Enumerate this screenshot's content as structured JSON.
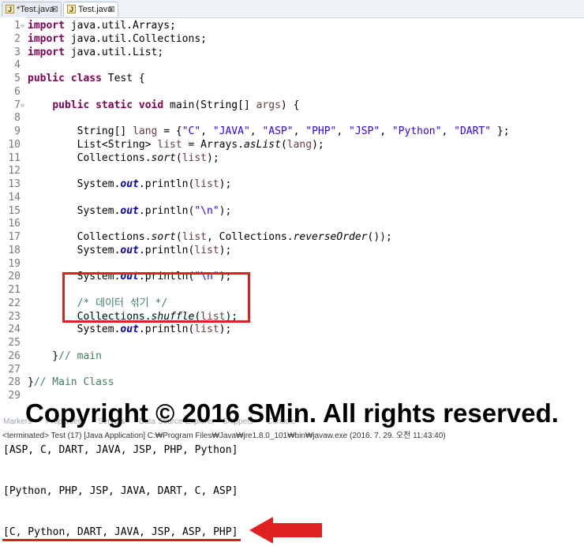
{
  "tabs": [
    {
      "label": "*Test.java",
      "close": "⊠"
    },
    {
      "label": "Test.java",
      "close": "⊠"
    }
  ],
  "code_lines": [
    {
      "n": "1",
      "fold": "⊖",
      "html": "<span class=\"kw\">import</span> java.util.Arrays;"
    },
    {
      "n": "2",
      "fold": "",
      "html": "<span class=\"kw\">import</span> java.util.Collections;"
    },
    {
      "n": "3",
      "fold": "",
      "html": "<span class=\"kw\">import</span> java.util.List;"
    },
    {
      "n": "4",
      "fold": "",
      "html": ""
    },
    {
      "n": "5",
      "fold": "",
      "html": "<span class=\"kw\">public class</span> Test {"
    },
    {
      "n": "6",
      "fold": "",
      "html": ""
    },
    {
      "n": "7",
      "fold": "⊖",
      "html": "    <span class=\"kw\">public static void</span> main(String[] <span class=\"var\">args</span>) {"
    },
    {
      "n": "8",
      "fold": "",
      "html": ""
    },
    {
      "n": "9",
      "fold": "",
      "html": "        String[] <span class=\"var\">lang</span> = {<span class=\"str\">\"C\"</span>, <span class=\"str\">\"JAVA\"</span>, <span class=\"str\">\"ASP\"</span>, <span class=\"str\">\"PHP\"</span>, <span class=\"str\">\"JSP\"</span>, <span class=\"str\">\"Python\"</span>, <span class=\"str\">\"DART\"</span> };"
    },
    {
      "n": "10",
      "fold": "",
      "html": "        List&lt;String&gt; <span class=\"var\">list</span> = Arrays.<span class=\"it\">asList</span>(<span class=\"var\">lang</span>);"
    },
    {
      "n": "11",
      "fold": "",
      "html": "        Collections.<span class=\"it\">sort</span>(<span class=\"var\">list</span>);"
    },
    {
      "n": "12",
      "fold": "",
      "html": ""
    },
    {
      "n": "13",
      "fold": "",
      "html": "        System.<span class=\"fld\">out</span>.println(<span class=\"var\">list</span>);"
    },
    {
      "n": "14",
      "fold": "",
      "html": ""
    },
    {
      "n": "15",
      "fold": "",
      "html": "        System.<span class=\"fld\">out</span>.println(<span class=\"str\">\"\\n\"</span>);"
    },
    {
      "n": "16",
      "fold": "",
      "html": ""
    },
    {
      "n": "17",
      "fold": "",
      "html": "        Collections.<span class=\"it\">sort</span>(<span class=\"var\">list</span>, Collections.<span class=\"it\">reverseOrder</span>());"
    },
    {
      "n": "18",
      "fold": "",
      "html": "        System.<span class=\"fld\">out</span>.println(<span class=\"var\">list</span>);"
    },
    {
      "n": "19",
      "fold": "",
      "html": ""
    },
    {
      "n": "20",
      "fold": "",
      "html": "        System.<span class=\"fld\">out</span>.println(<span class=\"str\">\"\\n\"</span>);"
    },
    {
      "n": "21",
      "fold": "",
      "html": ""
    },
    {
      "n": "22",
      "fold": "",
      "html": "        <span class=\"cm\">/* 데이터 섞기 */</span>"
    },
    {
      "n": "23",
      "fold": "",
      "html": "        Collections.<span class=\"it\">shuffle</span>(<span class=\"var\">list</span>);"
    },
    {
      "n": "24",
      "fold": "",
      "html": "        System.<span class=\"fld\">out</span>.println(<span class=\"var\">list</span>);"
    },
    {
      "n": "25",
      "fold": "",
      "html": ""
    },
    {
      "n": "26",
      "fold": "",
      "html": "    }<span class=\"cm\">// main</span>"
    },
    {
      "n": "27",
      "fold": "",
      "html": ""
    },
    {
      "n": "28",
      "fold": "",
      "html": "}<span class=\"cm\">// Main Class</span>"
    },
    {
      "n": "29",
      "fold": "",
      "html": ""
    }
  ],
  "copyright": "Copyright © 2016 SMin. All rights reserved.",
  "view_tabs": [
    "Markers",
    "Properties",
    "Servers",
    "Data Source Explorer",
    "Snippets",
    "Console"
  ],
  "console": {
    "status": "<terminated> Test (17) [Java Application] C:₩Program Files₩Java₩jre1.8.0_101₩bin₩javaw.exe (2016. 7. 29. 오전 11:43:40)",
    "lines": [
      "[ASP, C, DART, JAVA, JSP, PHP, Python]",
      "",
      "",
      "[Python, PHP, JSP, JAVA, DART, C, ASP]",
      "",
      "",
      "[C, Python, DART, JAVA, JSP, ASP, PHP]"
    ]
  },
  "annotation_color": "#e02020"
}
